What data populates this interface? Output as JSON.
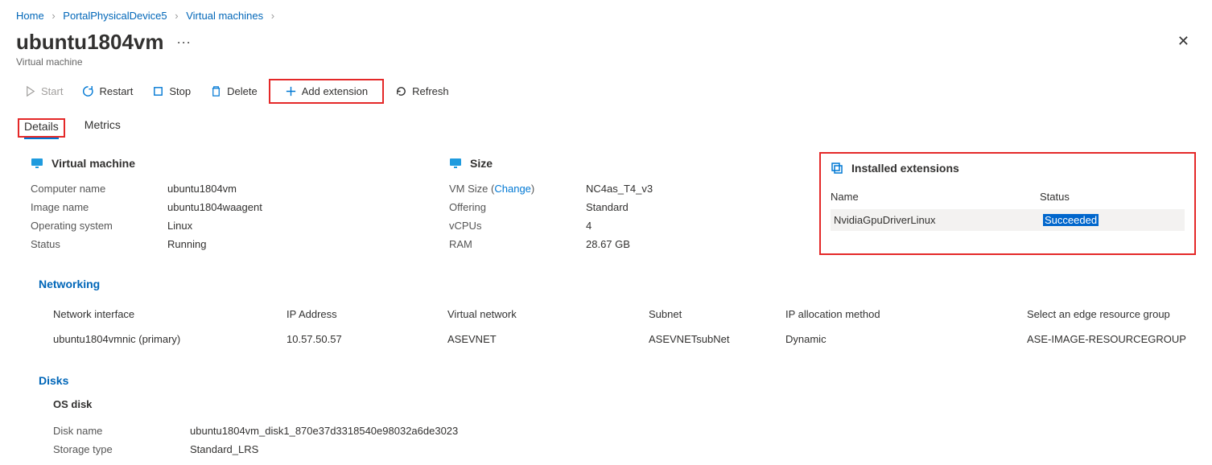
{
  "breadcrumb": {
    "home": "Home",
    "device": "PortalPhysicalDevice5",
    "vms": "Virtual machines"
  },
  "page": {
    "title": "ubuntu1804vm",
    "subtitle": "Virtual machine"
  },
  "toolbar": {
    "start": "Start",
    "restart": "Restart",
    "stop": "Stop",
    "delete": "Delete",
    "add_ext": "Add extension",
    "refresh": "Refresh"
  },
  "tabs": {
    "details": "Details",
    "metrics": "Metrics"
  },
  "vm_section": {
    "title": "Virtual machine",
    "computer_name_l": "Computer name",
    "computer_name_v": "ubuntu1804vm",
    "image_name_l": "Image name",
    "image_name_v": "ubuntu1804waagent",
    "os_l": "Operating system",
    "os_v": "Linux",
    "status_l": "Status",
    "status_v": "Running"
  },
  "size_section": {
    "title": "Size",
    "vmsize_l": "VM Size",
    "vmsize_change": "Change",
    "vmsize_v": "NC4as_T4_v3",
    "offering_l": "Offering",
    "offering_v": "Standard",
    "vcpus_l": "vCPUs",
    "vcpus_v": "4",
    "ram_l": "RAM",
    "ram_v": "28.67 GB"
  },
  "ext_section": {
    "title": "Installed extensions",
    "col_name": "Name",
    "col_status": "Status",
    "row_name": "NvidiaGpuDriverLinux",
    "row_status": "Succeeded"
  },
  "net_section": {
    "title": "Networking",
    "h1": "Network interface",
    "h2": "IP Address",
    "h3": "Virtual network",
    "h4": "Subnet",
    "h5": "IP allocation method",
    "h6": "Select an edge resource group",
    "r1": "ubuntu1804vmnic (primary)",
    "r2": "10.57.50.57",
    "r3": "ASEVNET",
    "r4": "ASEVNETsubNet",
    "r5": "Dynamic",
    "r6": "ASE-IMAGE-RESOURCEGROUP"
  },
  "disk_section": {
    "title": "Disks",
    "os_disk": "OS disk",
    "disk_name_l": "Disk name",
    "disk_name_v": "ubuntu1804vm_disk1_870e37d3318540e98032a6de3023",
    "storage_l": "Storage type",
    "storage_v": "Standard_LRS"
  }
}
